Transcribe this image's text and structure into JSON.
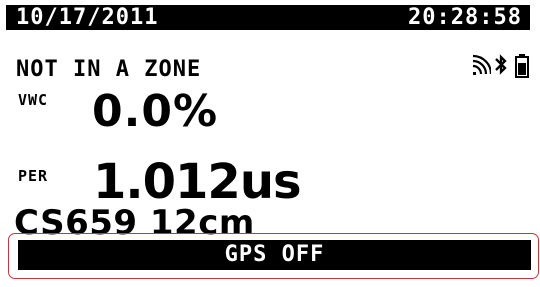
{
  "header": {
    "date": "10/17/2011",
    "time": "20:28:58"
  },
  "status": {
    "zone": "NOT IN A ZONE",
    "icons": [
      "signal-icon",
      "bluetooth-icon",
      "battery-icon"
    ]
  },
  "readings": {
    "vwc": {
      "label": "VWC",
      "value": "0.0%"
    },
    "per": {
      "label": "PER",
      "value": "1.012us"
    }
  },
  "sensor": {
    "label": "CS659 12cm"
  },
  "gps": {
    "status": "GPS OFF"
  },
  "colors": {
    "screen": "#ffffff",
    "text": "#000000",
    "highlight": "#c8363d"
  }
}
